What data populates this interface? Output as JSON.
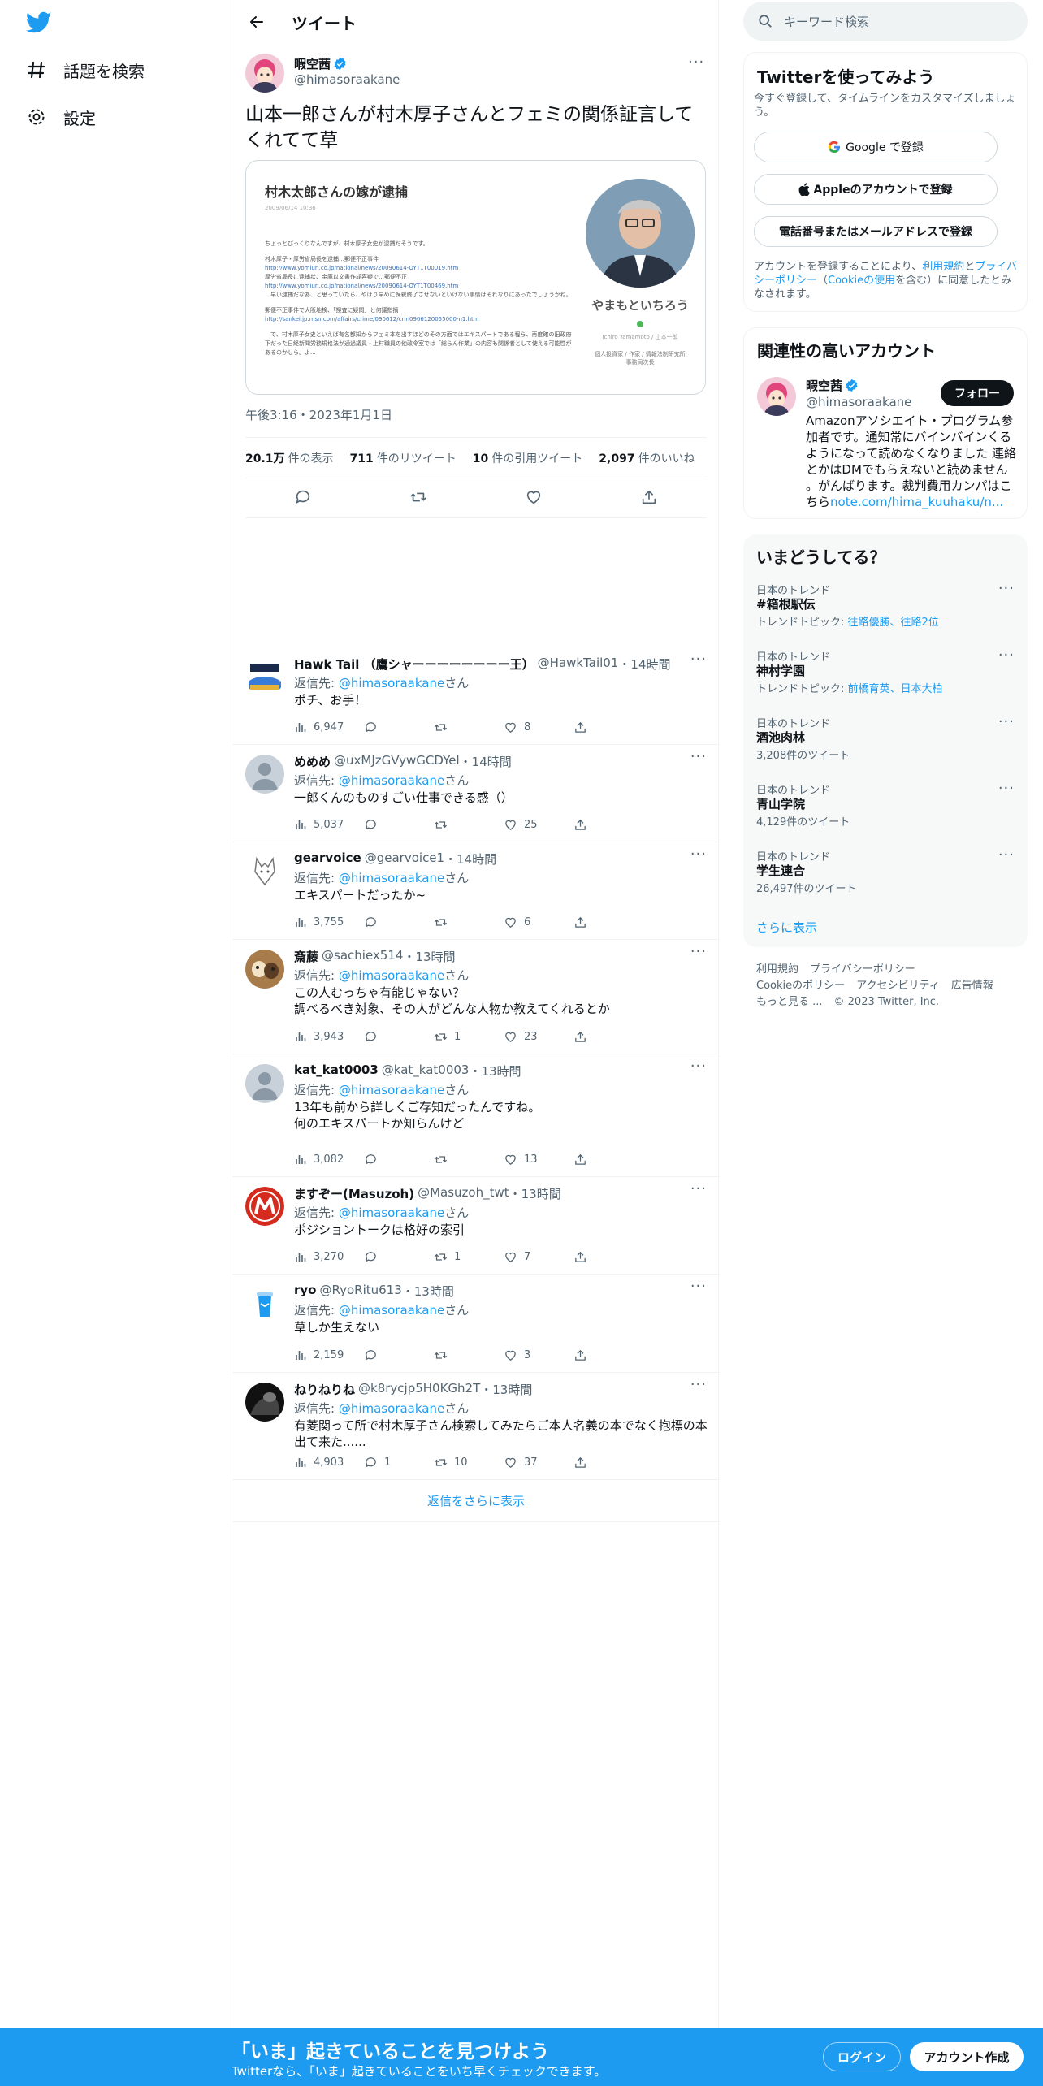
{
  "nav": {
    "explore_label": "話題を検索",
    "settings_label": "設定"
  },
  "header": {
    "title": "ツイート"
  },
  "tweet": {
    "name": "暇空茜",
    "handle": "@himasoraakane",
    "text": "山本一郎さんが村木厚子さんとフェミの関係証言してくれてて草",
    "time": "午後3:16・2023年1月1日",
    "stats": {
      "views_num": "20.1万",
      "views_label": "件の表示",
      "rt_num": "711",
      "rt_label": "件のリツイート",
      "quote_num": "10",
      "quote_label": "件の引用ツイート",
      "likes_num": "2,097",
      "likes_label": "件のいいね"
    },
    "card": {
      "title": "村木太郎さんの嫁が逮捕",
      "date": "2009/06/14 10:36",
      "lines": [
        "ちょっとびっくりなんですが、村木厚子女史が逮捕だそうです。",
        "",
        "村木厚子・厚労省局長を逮捕…郵便不正事件",
        "http://www.yomiuri.co.jp/national/news/20090614-OYT1T00019.htm",
        "厚労省局長に逮捕状、金庫以文書作成容疑で…郵便不正",
        "http://www.yomiuri.co.jp/national/news/20090614-OYT1T00469.htm",
        "　早い逮捕だなあ、と思っていたら、やはり早めに保釈終了させないといけない事情はそれなりにあったでしょうかね。",
        "",
        "郵便不正事件で大阪地検、「捜査に疑問」と何議指摘",
        "http://sankei.jp.msn.com/affairs/crime/090612/crm0906120055000-n1.htm",
        "",
        "　で、村木厚子女史といえば有名都知からフェミ本を出すほどのその方面ではエキスパートである程ら、再度確の旧政府下だった日経新聞労務規格法が通過議員 - 上村職員の他政令室では「総らん作業」の内容も関係者として使える可能性があるのかしら。よ..."
      ],
      "person_name": "やまもといちろう",
      "person_name_en": "Ichiro Yamamoto / 山本一郎",
      "person_desc": "個人投資家 / 作家 / 情報法制研究所\n事務局次長"
    }
  },
  "replies": [
    {
      "name": "Hawk Tail （鷹シャーーーーーーーー王）",
      "handle": "@HawkTail01",
      "time": "・14時間",
      "reply_to_prefix": "返信先: ",
      "reply_to": "@himasoraakane",
      "reply_to_suffix": "さん",
      "text": "ポチ、お手！",
      "views": "6,947",
      "replies": "",
      "rts": "",
      "likes": "8"
    },
    {
      "name": "めめめ",
      "handle": "@uxMJzGVywGCDYel",
      "time": "・14時間",
      "reply_to_prefix": "返信先: ",
      "reply_to": "@himasoraakane",
      "reply_to_suffix": "さん",
      "text": "一郎くんのものすごい仕事できる感（）",
      "views": "5,037",
      "replies": "",
      "rts": "",
      "likes": "25"
    },
    {
      "name": "gearvoice",
      "handle": "@gearvoice1",
      "time": "・14時間",
      "reply_to_prefix": "返信先: ",
      "reply_to": "@himasoraakane",
      "reply_to_suffix": "さん",
      "text": "エキスパートだったか~",
      "views": "3,755",
      "replies": "",
      "rts": "",
      "likes": "6"
    },
    {
      "name": "斎藤",
      "handle": "@sachiex514",
      "time": "・13時間",
      "reply_to_prefix": "返信先: ",
      "reply_to": "@himasoraakane",
      "reply_to_suffix": "さん",
      "text": "この人むっちゃ有能じゃない？\n調べるべき対象、その人がどんな人物か教えてくれるとか",
      "views": "3,943",
      "replies": "",
      "rts": "1",
      "likes": "23"
    },
    {
      "name": "kat_kat0003",
      "handle": "@kat_kat0003",
      "time": "・13時間",
      "reply_to_prefix": "返信先: ",
      "reply_to": "@himasoraakane",
      "reply_to_suffix": "さん",
      "text": "13年も前から詳しくご存知だったんですね。\n何のエキスパートか知らんけど",
      "views": "3,082",
      "replies": "",
      "rts": "",
      "likes": "13"
    },
    {
      "name": "ますぞー(Masuzoh)",
      "handle": "@Masuzoh_twt",
      "time": "・13時間",
      "reply_to_prefix": "返信先: ",
      "reply_to": "@himasoraakane",
      "reply_to_suffix": "さん",
      "text": "ポジショントークは格好の索引",
      "views": "3,270",
      "replies": "",
      "rts": "1",
      "likes": "7"
    },
    {
      "name": "ryo",
      "handle": "@RyoRitu613",
      "time": "・13時間",
      "reply_to_prefix": "返信先: ",
      "reply_to": "@himasoraakane",
      "reply_to_suffix": "さん",
      "text": "草しか生えない",
      "views": "2,159",
      "replies": "",
      "rts": "",
      "likes": "3"
    },
    {
      "name": "ねりねりね",
      "handle": "@k8rycjp5H0KGh2T",
      "time": "・13時間",
      "reply_to_prefix": "返信先: ",
      "reply_to": "@himasoraakane",
      "reply_to_suffix": "さん",
      "text": "有菱関って所で村木厚子さん検索してみたらご本人名義の本でなく抱標の本出て来た......",
      "views": "4,903",
      "replies": "1",
      "rts": "10",
      "likes": "37"
    }
  ],
  "show_more_replies": "返信をさらに表示",
  "search": {
    "placeholder": "キーワード検索"
  },
  "signup_panel": {
    "title": "Twitterを使ってみよう",
    "subtitle": "今すぐ登録して、タイムラインをカスタマイズしましょう。",
    "google": "Google で登録",
    "apple": "Appleのアカウントで登録",
    "phone": "電話番号またはメールアドレスで登録",
    "legal_1": "アカウントを登録することにより、",
    "legal_terms": "利用規約",
    "legal_2": "と",
    "legal_privacy": "プライバシーポリシー",
    "legal_3": "（",
    "legal_cookie": "Cookieの使用",
    "legal_4": "を含む）に同意したとみなされます。"
  },
  "related": {
    "title": "関連性の高いアカウント",
    "name": "暇空茜",
    "handle": "@himasoraakane",
    "follow": "フォロー",
    "bio": "Amazonアソシエイト・プログラム参加者です。通知常にバインバインくるようになって読めなくなりました 連絡とかはDMでもらえないと読めません 。がんばります。裁判費用カンパはこちら",
    "bio_link": "note.com/hima_kuuhaku/n..."
  },
  "trends": {
    "title": "いまどうしてる？",
    "items": [
      {
        "cat": "日本のトレンド",
        "name": "#箱根駅伝",
        "sub_prefix": "トレンドトピック: ",
        "sub_link": "往路優勝、往路2位",
        "sub": ""
      },
      {
        "cat": "日本のトレンド",
        "name": "神村学園",
        "sub_prefix": "トレンドトピック: ",
        "sub_link": "前橋育英、日本大柏",
        "sub": ""
      },
      {
        "cat": "日本のトレンド",
        "name": "酒池肉林",
        "sub_prefix": "",
        "sub_link": "",
        "sub": "3,208件のツイート"
      },
      {
        "cat": "日本のトレンド",
        "name": "青山学院",
        "sub_prefix": "",
        "sub_link": "",
        "sub": "4,129件のツイート"
      },
      {
        "cat": "日本のトレンド",
        "name": "学生連合",
        "sub_prefix": "",
        "sub_link": "",
        "sub": "26,497件のツイート"
      }
    ],
    "show_more": "さらに表示"
  },
  "footer": {
    "terms": "利用規約",
    "privacy": "プライバシーポリシー",
    "cookie": "Cookieのポリシー",
    "accessibility": "アクセシビリティ",
    "ads": "広告情報",
    "more": "もっと見る ...",
    "copyright": "© 2023 Twitter, Inc."
  },
  "bottombar": {
    "title": "「いま」起きていることを見つけよう",
    "subtitle": "Twitterなら、「いま」起きていることをいち早くチェックできます。",
    "login": "ログイン",
    "signup": "アカウント作成"
  },
  "colors": {
    "accent": "#1d9bf0",
    "text": "#0f1419",
    "secondary": "#536471",
    "border": "#eff3f4"
  }
}
